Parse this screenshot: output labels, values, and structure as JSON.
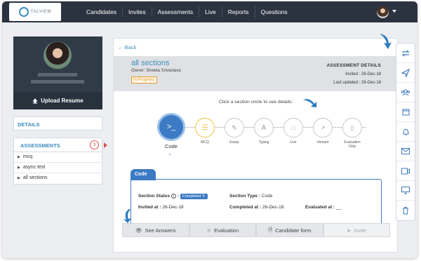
{
  "nav": {
    "logo": "TALVIEW",
    "items": [
      "Candidates",
      "Invites",
      "Assessments",
      "Live",
      "Reports",
      "Questions"
    ]
  },
  "profile": {
    "upload_label": "Upload Resume"
  },
  "sidebar": {
    "details_label": "DETAILS",
    "assessments_label": "ASSESSMENTS",
    "assessments_count": "3",
    "items": [
      "mcq",
      "async test",
      "all sections"
    ]
  },
  "main": {
    "back_label": "Back",
    "title": "all sections",
    "owner": "Owner: Shweta Srivastava",
    "status": "In Progress",
    "details_heading": "ASSESSMENT DETAILS",
    "invited": "Invited : 26-Dec-18",
    "last_updated": "Last updated : 26-Dec-18",
    "hint": "Click a section circle to see details:",
    "sections": [
      "Code",
      "MCQ",
      "Essay",
      "Typing",
      "Live",
      "Versant",
      "Evaluation Only"
    ],
    "code_tab": "Code",
    "section_status_label": "Section Status",
    "section_status_value": "Completed",
    "section_type_label": "Section Type :",
    "section_type_value": "Code",
    "invited_at_label": "Invited at :",
    "invited_at_value": "26-Dec-18",
    "completed_at_label": "Completed at :",
    "completed_at_value": "26-Dec-18",
    "evaluated_at_label": "Evaluated at :",
    "evaluated_at_value": "__",
    "buttons": [
      "See Answers",
      "Evaluation",
      "Candidate form",
      "Invite"
    ]
  },
  "colors": {
    "accent": "#3c7ac4",
    "topbar": "#2b3240",
    "status": "#e89a2c",
    "badge": "#d9534f"
  }
}
